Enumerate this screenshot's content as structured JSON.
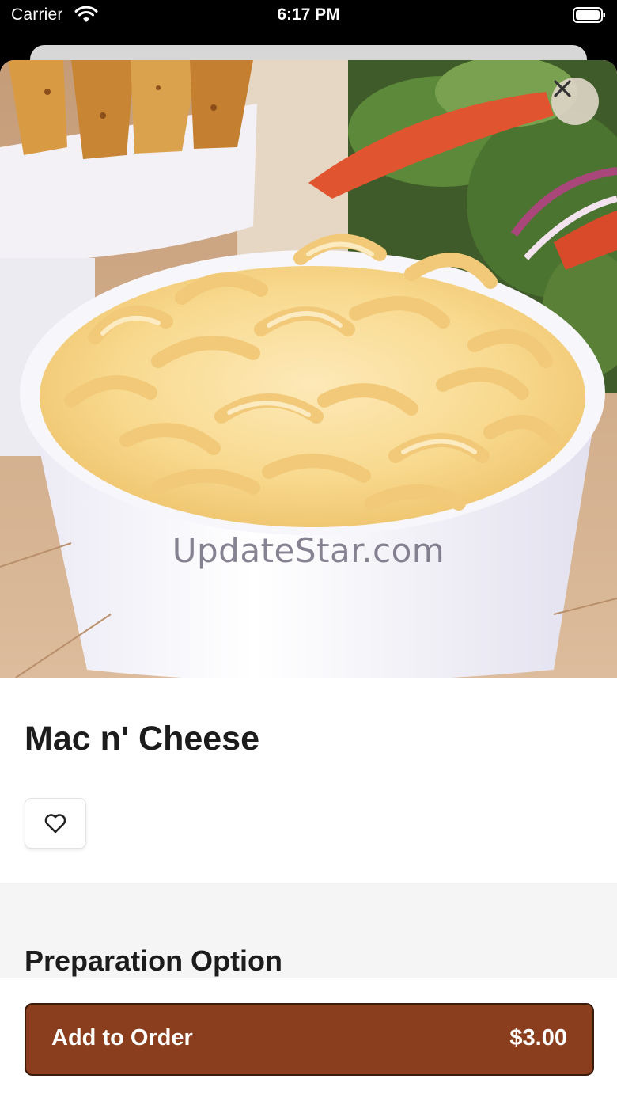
{
  "status_bar": {
    "carrier": "Carrier",
    "time": "6:17 PM"
  },
  "hero": {
    "watermark": "UpdateStar.com",
    "close_icon": "close-icon"
  },
  "item": {
    "name": "Mac n' Cheese",
    "favorite_icon": "heart-icon"
  },
  "options": {
    "section_title": "Preparation Option"
  },
  "cart": {
    "add_label": "Add to Order",
    "price": "$3.00"
  },
  "colors": {
    "accent": "#8b3e1d",
    "accent_border": "#3b1b0c"
  }
}
